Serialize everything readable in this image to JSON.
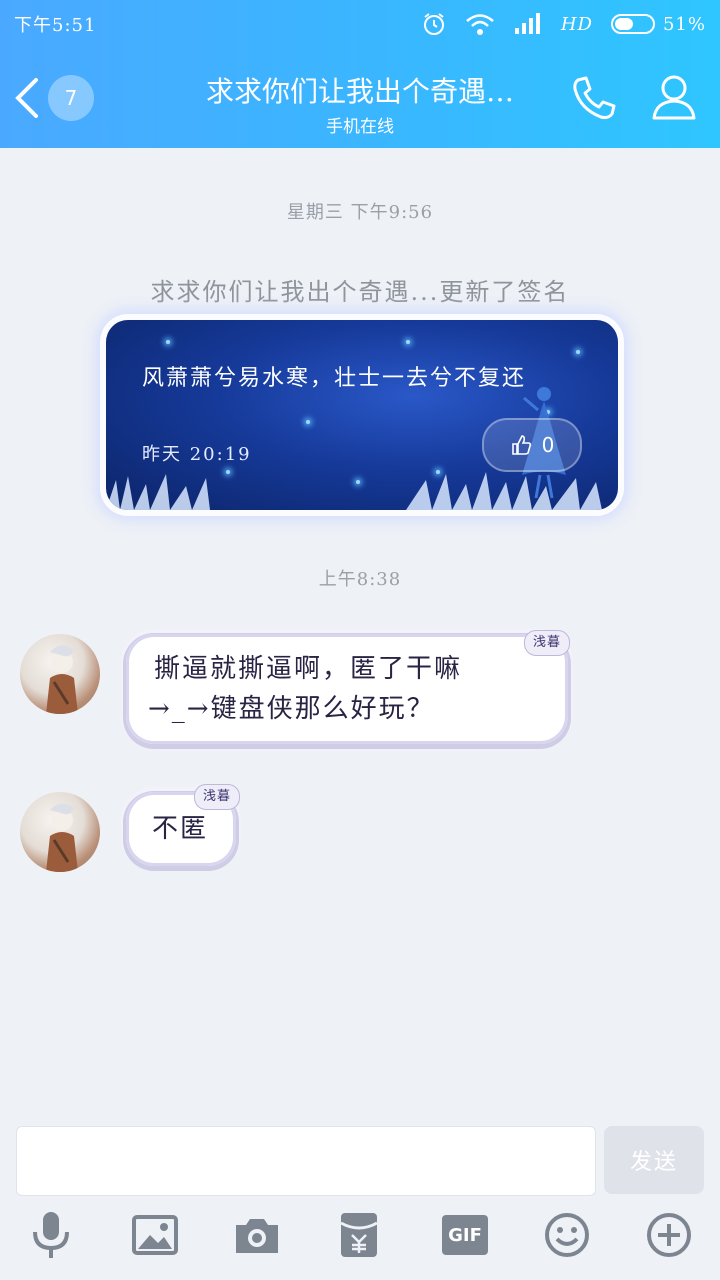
{
  "status_bar": {
    "time": "下午5:51",
    "network": "HD",
    "battery": "51%",
    "battery_level": 0.51
  },
  "header": {
    "unread_count": "7",
    "title": "求求你们让我出个奇遇…",
    "subtitle": "手机在线",
    "icons": [
      "back-icon",
      "phone-icon",
      "profile-icon"
    ]
  },
  "chat": {
    "timestamp_1": "星期三 下午9:56",
    "signature_notice": "求求你们让我出个奇遇...更新了签名",
    "signature_card": {
      "text": "风萧萧兮易水寒，壮士一去兮不复还",
      "time": "昨天 20:19",
      "likes": "0"
    },
    "timestamp_2": "上午8:38",
    "messages": [
      {
        "line1": "撕逼就撕逼啊，匿了干嘛",
        "line2": "→_→键盘侠那么好玩？",
        "tag": "浅暮"
      },
      {
        "line1": "不匿",
        "tag": "浅暮"
      }
    ]
  },
  "input": {
    "placeholder": "",
    "send_label": "发送"
  },
  "toolbar": {
    "gif_label": "GIF",
    "icons": [
      "mic-icon",
      "image-icon",
      "camera-icon",
      "red-packet-icon",
      "gif-icon",
      "emoji-icon",
      "plus-icon"
    ]
  }
}
